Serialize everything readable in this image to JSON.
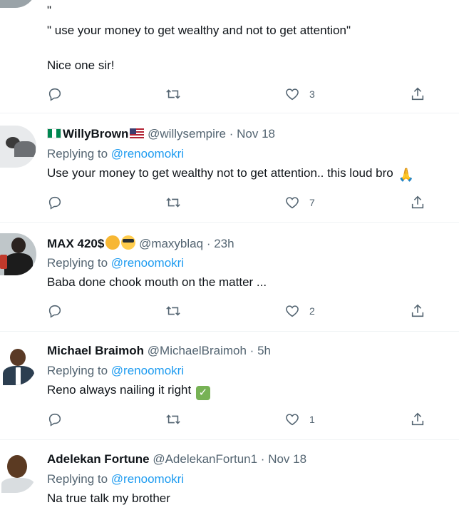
{
  "tweets": [
    {
      "id": "t0",
      "top_avatar": true,
      "text_lines": [
        "\"",
        "\" use your money to get wealthy and not to get attention\"",
        "Nice one sir!"
      ],
      "reply_count": "",
      "retweet_count": "",
      "like_count": "3"
    },
    {
      "id": "t1",
      "name": "WillyBrown",
      "handle": "@willysempire",
      "dot": "·",
      "time": "Nov 18",
      "replying_prefix": "Replying to",
      "replying_mention": "@renoomokri",
      "text": "Use your money to get wealthy not to get attention.. this loud bro",
      "like_count": "7"
    },
    {
      "id": "t2",
      "name": "MAX 420$",
      "handle": "@maxyblaq",
      "dot": "·",
      "time": "23h",
      "replying_prefix": "Replying to",
      "replying_mention": "@renoomokri",
      "text": "Baba done chook mouth on the matter ...",
      "like_count": "2"
    },
    {
      "id": "t3",
      "name": "Michael Braimoh",
      "handle": "@MichaelBraimoh",
      "dot": "·",
      "time": "5h",
      "replying_prefix": "Replying to",
      "replying_mention": "@renoomokri",
      "text": "Reno always  nailing  it right",
      "like_count": "1"
    },
    {
      "id": "t4",
      "name": "Adelekan Fortune",
      "handle": "@AdelekanFortun1",
      "dot": "·",
      "time": "Nov 18",
      "replying_prefix": "Replying to",
      "replying_mention": "@renoomokri",
      "text": "Na true talk my brother"
    }
  ],
  "icons": {
    "reply": "reply-icon",
    "retweet": "retweet-icon",
    "like": "heart-icon",
    "share": "share-icon"
  },
  "colors": {
    "link": "#1d9bf0",
    "secondary_text": "#536471",
    "divider": "#eff3f4"
  }
}
